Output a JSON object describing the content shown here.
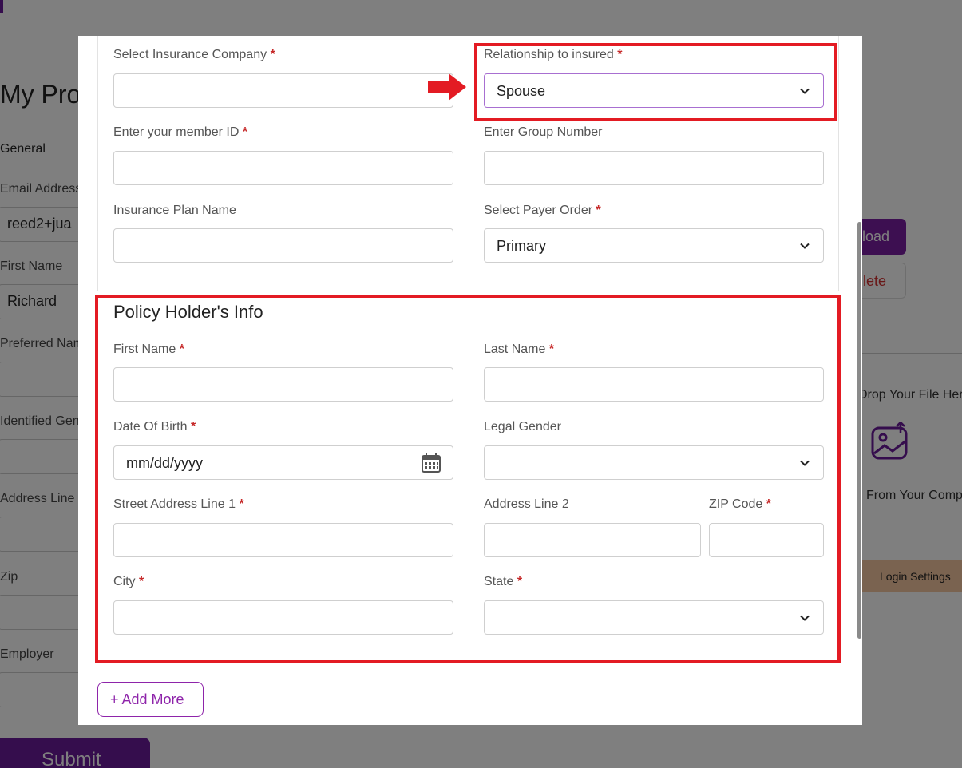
{
  "background": {
    "page_title": "My Pro",
    "section": "General",
    "labels": [
      {
        "text": "Email Address"
      },
      {
        "text": "First Name"
      },
      {
        "text": "Preferred Nam"
      },
      {
        "text": "Identified Gen"
      },
      {
        "text": "Address Line"
      },
      {
        "text": "Zip"
      },
      {
        "text": "Employer"
      }
    ],
    "email_value": "reed2+jua",
    "first_name_value": "Richard",
    "submit_label": "Submit",
    "upload_label": "load",
    "delete_label": "lete",
    "drop_text": "Drop Your File Her",
    "from_computer": "From Your Comp",
    "login_settings": "Login Settings"
  },
  "modal": {
    "insurance_company": {
      "label": "Select Insurance Company",
      "required": "*",
      "value": ""
    },
    "relationship": {
      "label": "Relationship to insured",
      "required": "*",
      "value": "Spouse"
    },
    "member_id": {
      "label": "Enter your member ID",
      "required": "*",
      "value": ""
    },
    "group_number": {
      "label": "Enter Group Number",
      "value": ""
    },
    "plan_name": {
      "label": "Insurance Plan Name",
      "value": ""
    },
    "payer_order": {
      "label": "Select Payer Order",
      "required": "*",
      "value": "Primary"
    },
    "policy_holder": {
      "title": "Policy Holder's Info",
      "first_name": {
        "label": "First Name",
        "required": "*",
        "value": ""
      },
      "last_name": {
        "label": "Last Name",
        "required": "*",
        "value": ""
      },
      "dob": {
        "label": "Date Of Birth",
        "required": "*",
        "placeholder": "mm/dd/yyyy"
      },
      "legal_gender": {
        "label": "Legal Gender",
        "value": ""
      },
      "street1": {
        "label": "Street Address Line 1",
        "required": "*",
        "value": ""
      },
      "address2": {
        "label": "Address Line 2",
        "value": ""
      },
      "zip": {
        "label": "ZIP Code",
        "required": "*",
        "value": ""
      },
      "city": {
        "label": "City",
        "required": "*",
        "value": ""
      },
      "state": {
        "label": "State",
        "required": "*",
        "value": ""
      }
    },
    "add_more_label": "+ Add More"
  },
  "colors": {
    "brand_purple": "#8e24aa",
    "highlight_red": "#e31b23",
    "required_red": "#c62828"
  },
  "icons": [
    "chevron-down-icon",
    "calendar-icon",
    "image-upload-icon",
    "red-arrow-icon"
  ]
}
